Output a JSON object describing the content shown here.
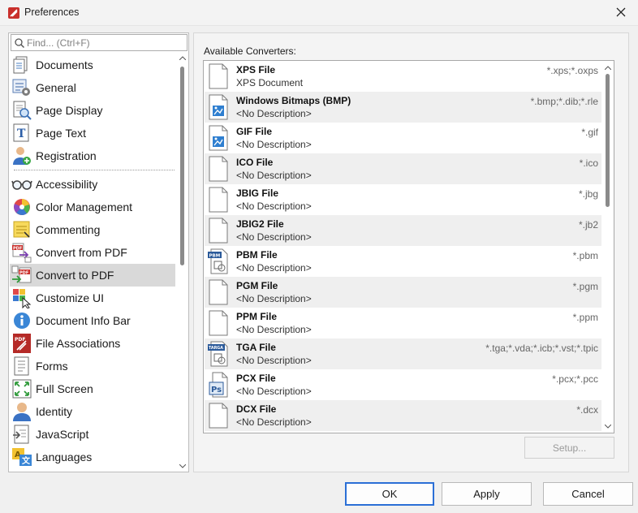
{
  "window": {
    "title": "Preferences",
    "icon": "pdf-xchange-app-icon",
    "close_icon": "close-icon"
  },
  "sidebar": {
    "search_placeholder": "Find... (Ctrl+F)",
    "search_value": "",
    "group_top": [
      {
        "label": "Documents",
        "icon": "documents-icon"
      },
      {
        "label": "General",
        "icon": "general-settings-icon"
      },
      {
        "label": "Page Display",
        "icon": "page-display-icon"
      },
      {
        "label": "Page Text",
        "icon": "page-text-icon"
      },
      {
        "label": "Registration",
        "icon": "registration-user-icon"
      }
    ],
    "group_main": [
      {
        "label": "Accessibility",
        "icon": "glasses-icon"
      },
      {
        "label": "Color Management",
        "icon": "color-wheel-icon"
      },
      {
        "label": "Commenting",
        "icon": "sticky-note-icon"
      },
      {
        "label": "Convert from PDF",
        "icon": "convert-from-pdf-icon"
      },
      {
        "label": "Convert to PDF",
        "icon": "convert-to-pdf-icon",
        "selected": true
      },
      {
        "label": "Customize UI",
        "icon": "customize-ui-icon"
      },
      {
        "label": "Document Info Bar",
        "icon": "info-icon"
      },
      {
        "label": "File Associations",
        "icon": "pdf-file-association-icon"
      },
      {
        "label": "Forms",
        "icon": "forms-icon"
      },
      {
        "label": "Full Screen",
        "icon": "full-screen-icon"
      },
      {
        "label": "Identity",
        "icon": "identity-user-icon"
      },
      {
        "label": "JavaScript",
        "icon": "javascript-icon"
      },
      {
        "label": "Languages",
        "icon": "languages-icon"
      }
    ]
  },
  "main": {
    "section_label": "Available Converters:",
    "converters": [
      {
        "name": "XPS File",
        "description": "XPS Document",
        "extensions": "*.xps;*.oxps",
        "icon": "blank-file-icon"
      },
      {
        "name": "Windows Bitmaps (BMP)",
        "description": "<No Description>",
        "extensions": "*.bmp;*.dib;*.rle",
        "icon": "image-file-icon"
      },
      {
        "name": "GIF File",
        "description": "<No Description>",
        "extensions": "*.gif",
        "icon": "image-file-icon"
      },
      {
        "name": "ICO File",
        "description": "<No Description>",
        "extensions": "*.ico",
        "icon": "blank-file-icon"
      },
      {
        "name": "JBIG File",
        "description": "<No Description>",
        "extensions": "*.jbg",
        "icon": "blank-file-icon"
      },
      {
        "name": "JBIG2 File",
        "description": "<No Description>",
        "extensions": "*.jb2",
        "icon": "blank-file-icon"
      },
      {
        "name": "PBM File",
        "description": "<No Description>",
        "extensions": "*.pbm",
        "icon": "pbm-file-icon",
        "badge": "PBM"
      },
      {
        "name": "PGM File",
        "description": "<No Description>",
        "extensions": "*.pgm",
        "icon": "blank-file-icon"
      },
      {
        "name": "PPM File",
        "description": "<No Description>",
        "extensions": "*.ppm",
        "icon": "blank-file-icon"
      },
      {
        "name": "TGA File",
        "description": "<No Description>",
        "extensions": "*.tga;*.vda;*.icb;*.vst;*.tpic",
        "icon": "targa-file-icon",
        "badge": "TARGA"
      },
      {
        "name": "PCX File",
        "description": "<No Description>",
        "extensions": "*.pcx;*.pcc",
        "icon": "photoshop-file-icon",
        "badge": "Ps"
      },
      {
        "name": "DCX File",
        "description": "<No Description>",
        "extensions": "*.dcx",
        "icon": "blank-file-icon"
      }
    ],
    "setup_button": {
      "label": "Setup...",
      "enabled": false
    }
  },
  "footer": {
    "ok": "OK",
    "apply": "Apply",
    "cancel": "Cancel"
  },
  "colors": {
    "accent_focus": "#2b6fd6",
    "selected_item": "#d9d9d9",
    "app_red": "#c9302c"
  }
}
